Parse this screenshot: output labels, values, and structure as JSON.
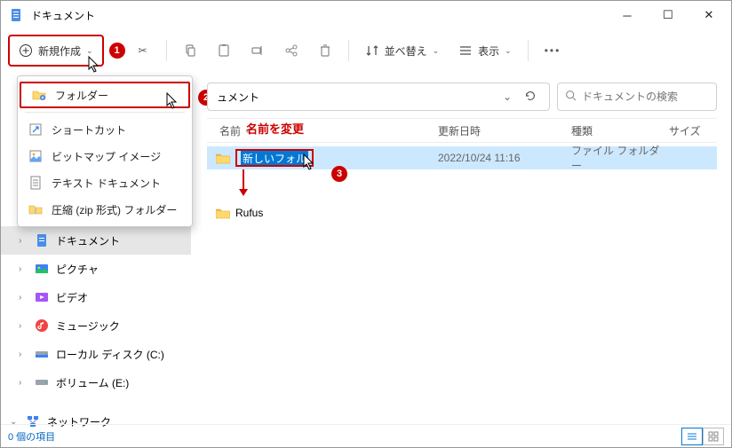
{
  "window": {
    "title": "ドキュメント"
  },
  "toolbar": {
    "new_label": "新規作成",
    "sort_label": "並べ替え",
    "view_label": "表示"
  },
  "ctxmenu": {
    "folder": "フォルダー",
    "shortcut": "ショートカット",
    "bitmap": "ビットマップ イメージ",
    "textdoc": "テキスト ドキュメント",
    "zip": "圧縮 (zip 形式) フォルダー"
  },
  "address": {
    "crumb_suffix": "ュメント"
  },
  "search": {
    "placeholder": "ドキュメントの検索"
  },
  "columns": {
    "name": "名前",
    "date": "更新日時",
    "type": "種類",
    "size": "サイズ"
  },
  "rows": [
    {
      "name": "新しいフォルダー",
      "date": "2022/10/24 11:16",
      "type": "ファイル フォルダー",
      "editing": true
    },
    {
      "name": "Rufus",
      "date": "",
      "type": "",
      "editing": false
    }
  ],
  "sidebar": {
    "documents": "ドキュメント",
    "pictures": "ピクチャ",
    "videos": "ビデオ",
    "music": "ミュージック",
    "localdisk": "ローカル ディスク (C:)",
    "volume": "ボリューム (E:)",
    "network": "ネットワーク"
  },
  "statusbar": {
    "count": "0 個の項目"
  },
  "annotations": {
    "rename": "名前を変更",
    "b1": "1",
    "b2": "2",
    "b3": "3"
  }
}
